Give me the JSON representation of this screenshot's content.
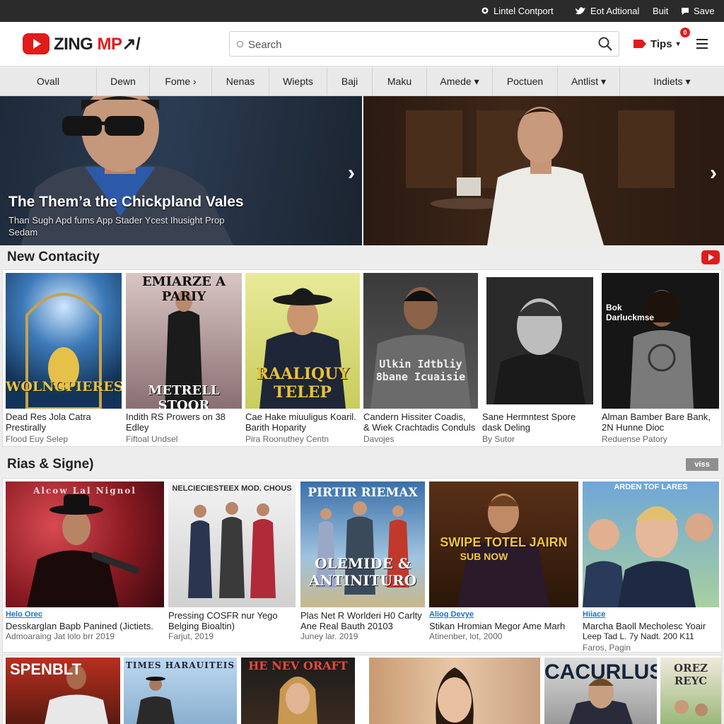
{
  "topbar": {
    "links": [
      {
        "icon": "pin-icon",
        "label": "Lintel Contport"
      },
      {
        "icon": "bird-icon",
        "label": "Eot Adtional"
      },
      {
        "icon": "",
        "label": "Buit"
      },
      {
        "icon": "chat-icon",
        "label": "Save"
      }
    ]
  },
  "header": {
    "logo_text": "ZING",
    "logo_accent": "MP",
    "logo_tail": "↗/",
    "search_placeholder": "Search",
    "tips_label": "Tips",
    "tips_badge": "0"
  },
  "nav": {
    "tabs": [
      {
        "label": "Ovall",
        "width": 0
      },
      {
        "label": "Dewn"
      },
      {
        "label": "Fome ›"
      },
      {
        "label": "Nenas"
      },
      {
        "label": "Wiepts"
      },
      {
        "label": "Baji"
      },
      {
        "label": "Maku"
      },
      {
        "label": "Amede ▾"
      },
      {
        "label": "Poctuen"
      },
      {
        "label": "Antlist ▾"
      },
      {
        "label": "Indiets ▾"
      }
    ]
  },
  "hero": {
    "left": {
      "title": "The Them’a the Chickpland Vales",
      "subtitle": "Than Sugh Apd fums App Stader Ycest Ihusight Prop Sedam"
    }
  },
  "section1": {
    "title": "New Contacity",
    "cards": [
      {
        "poster": "WOLNGPIERES",
        "line1": "Dead Res Jola Catra",
        "line2": "Prestirally",
        "meta": "Flood Euy Selep"
      },
      {
        "poster": "EMIARZE A PARIY",
        "poster2": "METRELL STOOR",
        "line1": "Indith RS Prowers on 38",
        "line2": "Edley",
        "meta": "Fiftoal Undsel"
      },
      {
        "poster": "RAALIQUY TELEP",
        "line1": "Cae Hake miuuligus Koaril.",
        "line2": "Barith Hoparity",
        "meta": "Pira Roonuthey Centn"
      },
      {
        "poster": "Ulkin Idtbliy 8bane Icuaisie",
        "line1": "Candern Hissiter Coadis,",
        "line2": "& Wiek Crachtadis Conduls",
        "meta": "Davojes"
      },
      {
        "poster": "",
        "line1": "Sane Hermntest Spore",
        "line2": "dask Deling",
        "meta": "By Sutor"
      },
      {
        "poster": "Bok Darluckmse",
        "line1": "Alman Bamber Bare Bank,",
        "line2": "2N Hunne Dioc",
        "meta": "Reduense Patory"
      }
    ]
  },
  "section2": {
    "title": "Rias & Signe)",
    "view_label": "viss",
    "cards": [
      {
        "poster": "Alcow Lal Nignol",
        "tag": "Helo Orec",
        "line1": "Desskarglan Bapb Panined (Jictiets.",
        "meta": "Admoaraing Jat lolo brr 2019"
      },
      {
        "poster": "NELCIECIESTEEX MOD. CHOUS",
        "tag": "",
        "line1": "Pressing COSFR nur Yego",
        "line2": "Belging Bioaltin)",
        "meta": "Farjut, 2019"
      },
      {
        "poster": "PIRTIR RIEMAX",
        "poster2": "OLEMIDE & ANTINITURO",
        "tag": "",
        "line1": "Plas Net R Worlderi H0 Carlty",
        "line2": "Ane Real Bauth 20103",
        "meta": "Juney lar. 2019"
      },
      {
        "poster": "SWIPE TOTEL JAIRN",
        "poster2": "SUB NOW",
        "tag": "Aliog Devye",
        "line1": "Stikan Hromian Megor Ame Marh",
        "meta": "Atinenber, lot, 2000"
      },
      {
        "poster": "ARDEN TOF LARES",
        "tag": "Hiiace",
        "line1": "Marcha Baoll Mecholesc Yoair",
        "line2": "Leep Tad L. 7y Nadt. 200 K11",
        "meta": "Faros, Pagin"
      }
    ]
  },
  "section3": {
    "posters": [
      "SPENBLT",
      "TIMES HARAUITEIS",
      "HE NEV ORAFT",
      "",
      "CACURLUS",
      "OREZ REYC"
    ]
  },
  "colors": {
    "accent": "#e21b1b",
    "link": "#1a73c8"
  }
}
